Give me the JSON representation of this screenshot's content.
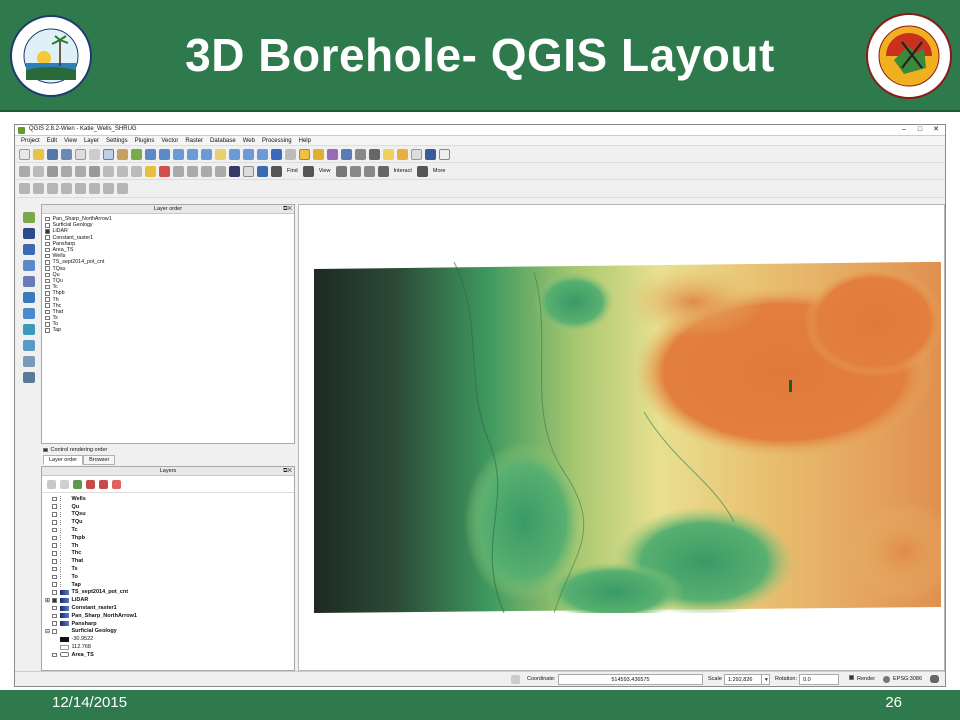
{
  "slide": {
    "title": "3D Borehole- QGIS Layout",
    "footer_date": "12/14/2015",
    "page_number": "26",
    "left_logo_text": "Florida Department of Environmental Protection",
    "right_logo_text": "FLORIDA GEOLOGICAL SURVEY",
    "right_logo_est": "EST. 1907"
  },
  "colors": {
    "header_green": "#2e7a4c",
    "map_low": "#1e2a22",
    "map_mid": "#3f9a60",
    "map_high": "#e07a3a"
  },
  "qgis": {
    "window_title": "QGIS 2.8.2-Wien - Katie_Wells_SHRUG",
    "menu": [
      "Project",
      "Edit",
      "View",
      "Layer",
      "Settings",
      "Plugins",
      "Vector",
      "Raster",
      "Database",
      "Web",
      "Processing",
      "Help"
    ],
    "toolbar_labels": {
      "find": "Find",
      "view": "View",
      "interact": "Interact",
      "more": "More"
    },
    "layer_order": {
      "title": "Layer order",
      "items": [
        {
          "name": "Pan_Sharp_NorthArrow1",
          "checked": false
        },
        {
          "name": "Surficial Geology",
          "checked": false
        },
        {
          "name": "LiDAR",
          "checked": true
        },
        {
          "name": "Constant_raster1",
          "checked": false
        },
        {
          "name": "Pansharp",
          "checked": false
        },
        {
          "name": "Area_TS",
          "checked": false
        },
        {
          "name": "Wells",
          "checked": false
        },
        {
          "name": "TS_sept2014_pot_cnt",
          "checked": false
        },
        {
          "name": "TQsu",
          "checked": false
        },
        {
          "name": "Qu",
          "checked": false
        },
        {
          "name": "TQu",
          "checked": false
        },
        {
          "name": "Tc",
          "checked": false
        },
        {
          "name": "Thpb",
          "checked": false
        },
        {
          "name": "Th",
          "checked": false
        },
        {
          "name": "Thc",
          "checked": false
        },
        {
          "name": "That",
          "checked": false
        },
        {
          "name": "Ts",
          "checked": false
        },
        {
          "name": "To",
          "checked": false
        },
        {
          "name": "Tap",
          "checked": false
        }
      ],
      "control_rendering_label": "Control rendering order"
    },
    "tabs": [
      "Layer order",
      "Browser"
    ],
    "layers_panel": {
      "title": "Layers",
      "items": [
        {
          "name": "Wells",
          "kind": "point"
        },
        {
          "name": "Qu",
          "kind": "point"
        },
        {
          "name": "TQsu",
          "kind": "point"
        },
        {
          "name": "TQu",
          "kind": "point"
        },
        {
          "name": "Tc",
          "kind": "point"
        },
        {
          "name": "Thpb",
          "kind": "point"
        },
        {
          "name": "Th",
          "kind": "point"
        },
        {
          "name": "Thc",
          "kind": "point"
        },
        {
          "name": "That",
          "kind": "point"
        },
        {
          "name": "Ts",
          "kind": "point"
        },
        {
          "name": "To",
          "kind": "point"
        },
        {
          "name": "Tap",
          "kind": "point"
        },
        {
          "name": "TS_sept2014_pot_cnt",
          "kind": "raster"
        },
        {
          "name": "LiDAR",
          "kind": "raster"
        },
        {
          "name": "Constant_raster1",
          "kind": "raster"
        },
        {
          "name": "Pan_Sharp_NorthArrow1",
          "kind": "raster"
        },
        {
          "name": "Pansharp",
          "kind": "raster"
        },
        {
          "name": "Surficial Geology",
          "kind": "group"
        },
        {
          "name": "-30.9522",
          "kind": "legend-dark"
        },
        {
          "name": "112.768",
          "kind": "legend-light"
        },
        {
          "name": "Area_TS",
          "kind": "polygon"
        }
      ]
    },
    "status": {
      "coordinate_label": "Coordinate:",
      "coordinate_value": "514593,436575",
      "scale_label": "Scale",
      "scale_value": "1:292,826",
      "rotation_label": "Rotation:",
      "rotation_value": "0.0",
      "render_label": "Render",
      "crs": "EPSG:3086"
    }
  }
}
